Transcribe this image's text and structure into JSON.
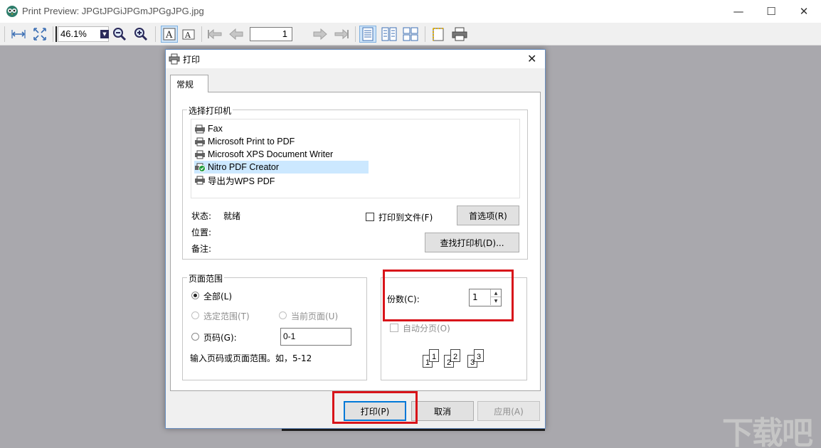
{
  "window": {
    "title": "Print Preview: JPGtJPGiJPGmJPGgJPG.jpg",
    "controls": {
      "minimize": "—",
      "maximize": "☐",
      "close": "✕"
    }
  },
  "toolbar": {
    "zoom_value": "46.1%",
    "page_number": "1",
    "icons": [
      "fit-width-icon",
      "fit-page-icon",
      "zoom-in-icon",
      "zoom-out-icon",
      "font-a-icon",
      "font-a-small-icon",
      "first-page-icon",
      "prev-page-icon",
      "next-page-icon",
      "last-page-icon",
      "one-page-icon",
      "two-pages-icon",
      "four-pages-icon",
      "page-setup-icon",
      "printer-icon"
    ]
  },
  "dialog": {
    "title": "打印",
    "tab_label": "常规",
    "select_printer": {
      "legend": "选择打印机",
      "printers": [
        {
          "name": "Fax"
        },
        {
          "name": "Microsoft Print to PDF"
        },
        {
          "name": "Microsoft XPS Document Writer"
        },
        {
          "name": "Nitro PDF Creator"
        },
        {
          "name": "导出为WPS PDF"
        }
      ],
      "selected_printer": "Nitro PDF Creator",
      "status_label": "状态:",
      "status_value": "就绪",
      "location_label": "位置:",
      "comment_label": "备注:",
      "print_to_file_label": "打印到文件(F)",
      "preferences_button": "首选项(R)",
      "find_printer_button": "查找打印机(D)..."
    },
    "page_range": {
      "legend": "页面范围",
      "all_label": "全部(L)",
      "selection_label": "选定范围(T)",
      "current_page_label": "当前页面(U)",
      "pages_label": "页码(G):",
      "pages_value": "0-1",
      "hint": "输入页码或页面范围。如，5-12"
    },
    "copies": {
      "copies_label": "份数(C):",
      "copies_value": "1",
      "collate_label": "自动分页(O)",
      "collate_pages": [
        "1",
        "1",
        "2",
        "2",
        "3",
        "3"
      ]
    },
    "buttons": {
      "print": "打印(P)",
      "cancel": "取消",
      "apply": "应用(A)"
    }
  },
  "colors": {
    "highlight": "#d8141a",
    "selected_row": "#cce8ff",
    "default_button_border": "#0078d7"
  },
  "watermark": {
    "text": "下载吧"
  }
}
